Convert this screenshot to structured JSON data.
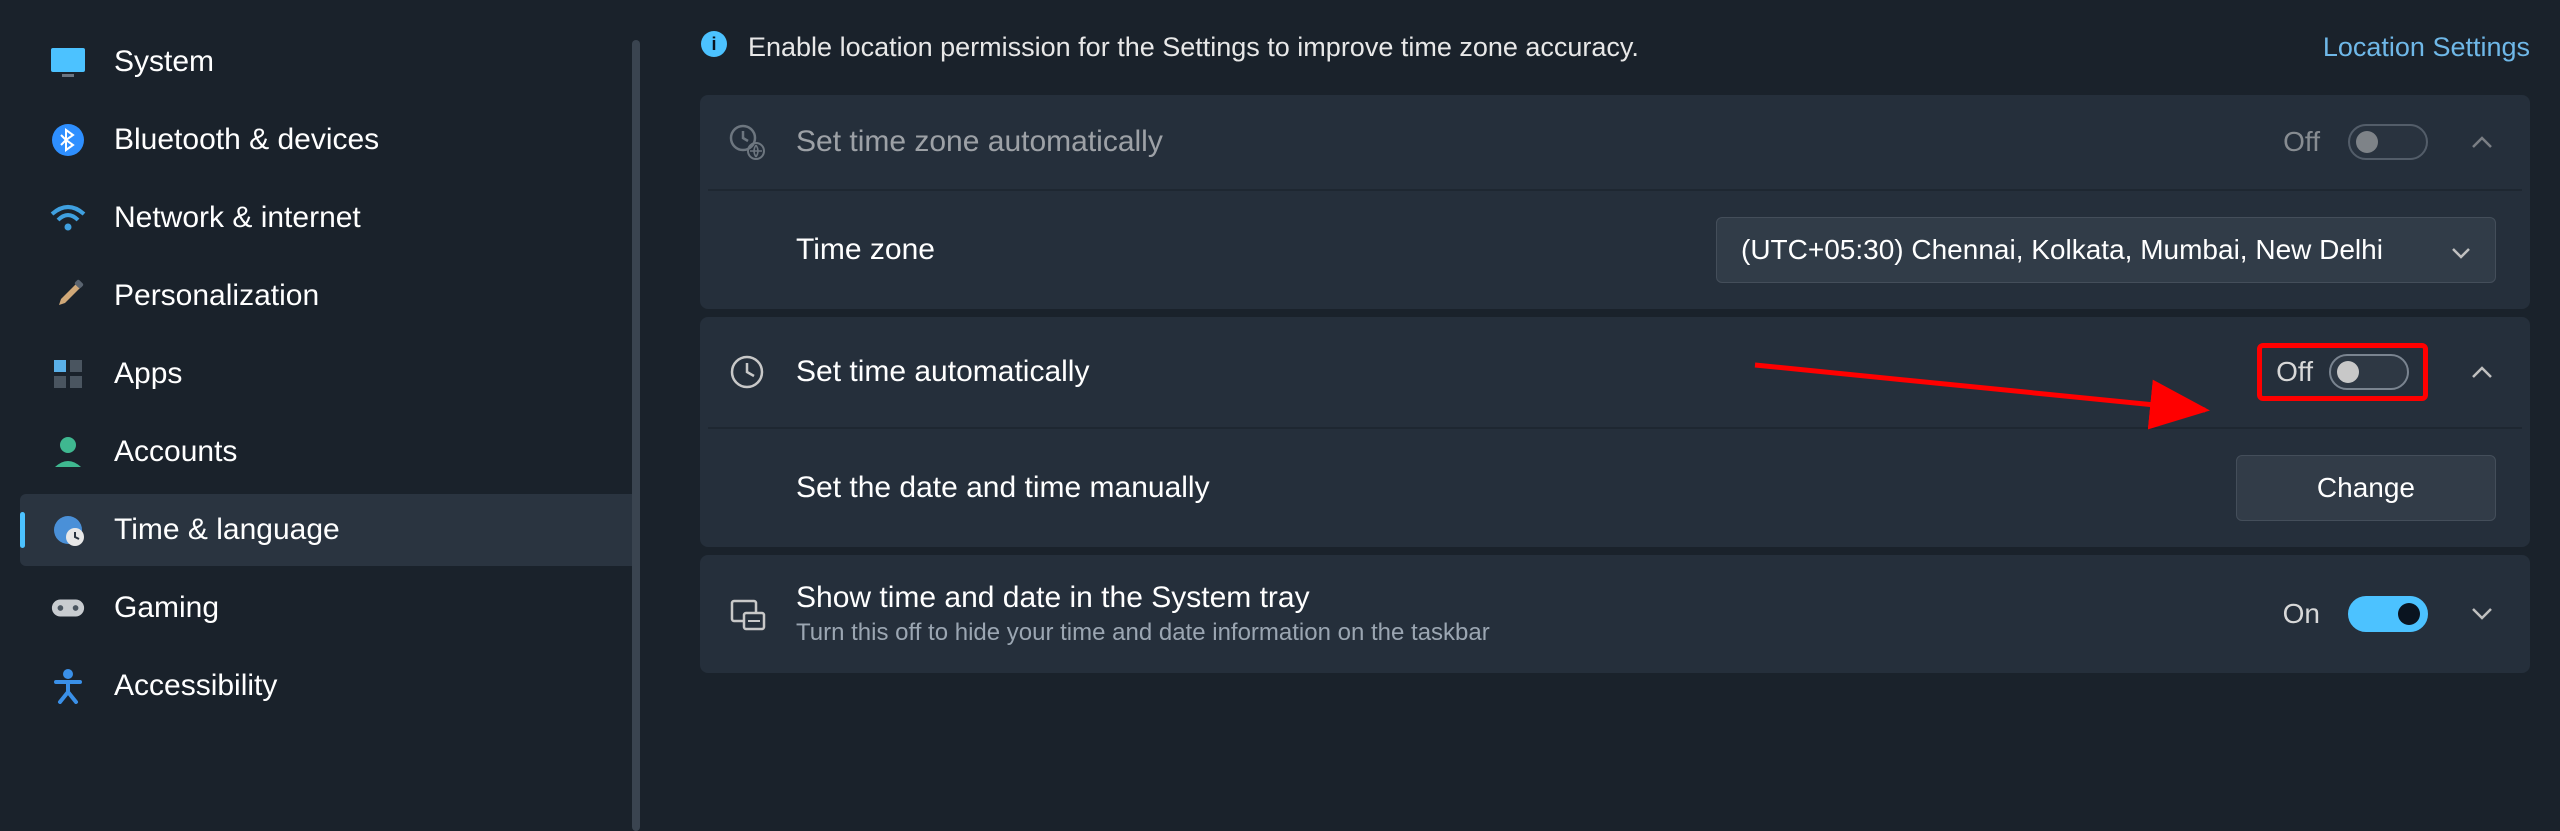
{
  "sidebar": {
    "items": [
      {
        "label": "System"
      },
      {
        "label": "Bluetooth & devices"
      },
      {
        "label": "Network & internet"
      },
      {
        "label": "Personalization"
      },
      {
        "label": "Apps"
      },
      {
        "label": "Accounts"
      },
      {
        "label": "Time & language"
      },
      {
        "label": "Gaming"
      },
      {
        "label": "Accessibility"
      }
    ]
  },
  "banner": {
    "text": "Enable location permission for the Settings to improve time zone accuracy.",
    "link": "Location Settings"
  },
  "rows": {
    "autoTZ": {
      "title": "Set time zone automatically",
      "state": "Off"
    },
    "tz": {
      "title": "Time zone",
      "value": "(UTC+05:30) Chennai, Kolkata, Mumbai, New Delhi"
    },
    "autoTime": {
      "title": "Set time automatically",
      "state": "Off"
    },
    "manual": {
      "title": "Set the date and time manually",
      "button": "Change"
    },
    "tray": {
      "title": "Show time and date in the System tray",
      "sub": "Turn this off to hide your time and date information on the taskbar",
      "state": "On"
    }
  }
}
